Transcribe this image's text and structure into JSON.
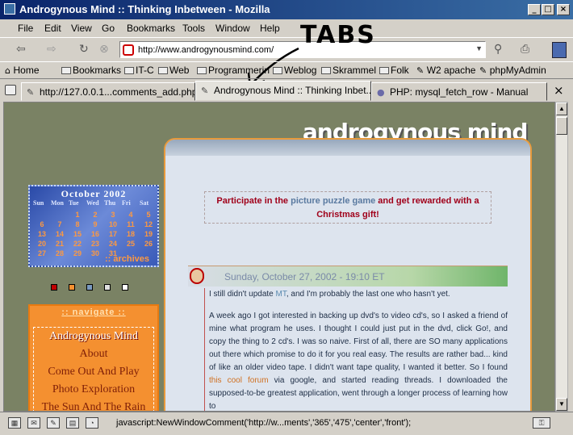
{
  "window": {
    "title": "Androgynous Mind :: Thinking Inbetween - Mozilla"
  },
  "menu": [
    "File",
    "Edit",
    "View",
    "Go",
    "Bookmarks",
    "Tools",
    "Window",
    "Help"
  ],
  "urlbar": {
    "value": "http://www.androgynousmind.com/"
  },
  "annotation": "TABS",
  "bookmarks": [
    "Home",
    "Bookmarks",
    "IT-C",
    "Web",
    "Programmering",
    "Weblog",
    "Skrammel",
    "Folk",
    "W2 apache",
    "phpMyAdmin"
  ],
  "tabs": [
    {
      "label": "http://127.0.0.1...comments_add.php"
    },
    {
      "label": "Androgynous Mind :: Thinking Inbet..."
    },
    {
      "label": "PHP: mysql_fetch_row - Manual"
    }
  ],
  "page": {
    "logo": "androgynous mind",
    "promo": {
      "pre": "Participate in the ",
      "link": "picture puzzle game",
      "post": " and get rewarded with a Christmas gift!"
    },
    "post": {
      "date": "Sunday, October 27, 2002 - 19:10 ET",
      "p1_a": "I still didn't update ",
      "p1_link": "MT",
      "p1_b": ", and I'm probably the last one who hasn't yet.",
      "p2_a": "A week ago I got interested in backing up dvd's to video cd's, so I asked a friend of mine what program he uses. I thought I could just put in the dvd, click Go!, and copy the thing to 2 cd's. I was so naive. First of all, there are SO many applications out there which promise to do it for you real easy. The results are rather bad... kind of like an older video tape. I didn't want tape quality, I wanted it better. So I found ",
      "p2_link": "this cool forum",
      "p2_b": " via google, and started reading threads. I downloaded the supposed-to-be greatest application, went through a longer process of learning how to"
    },
    "calendar": {
      "title": "October 2002",
      "days": [
        "Sun",
        "Mon",
        "Tue",
        "Wed",
        "Thu",
        "Fri",
        "Sat"
      ],
      "dates": [
        "",
        "",
        "1",
        "2",
        "3",
        "4",
        "5",
        "6",
        "7",
        "8",
        "9",
        "10",
        "11",
        "12",
        "13",
        "14",
        "15",
        "16",
        "17",
        "18",
        "19",
        "20",
        "21",
        "22",
        "23",
        "24",
        "25",
        "26",
        "27",
        "28",
        "29",
        "30",
        "31",
        "",
        ""
      ],
      "archives": ":: archives"
    },
    "squares": [
      "#c00000",
      "#f49030",
      "#7a9ac0",
      "#e0e0e0",
      "#ffffff"
    ],
    "navigate": {
      "title": ":: navigate ::",
      "items": [
        "Androgynous Mind",
        "About",
        "Come Out And Play",
        "Photo Exploration",
        "The Sun And The Rain"
      ]
    }
  },
  "status": {
    "text": "javascript:NewWindowComment('http://w...ments','365','475','center','front');"
  }
}
